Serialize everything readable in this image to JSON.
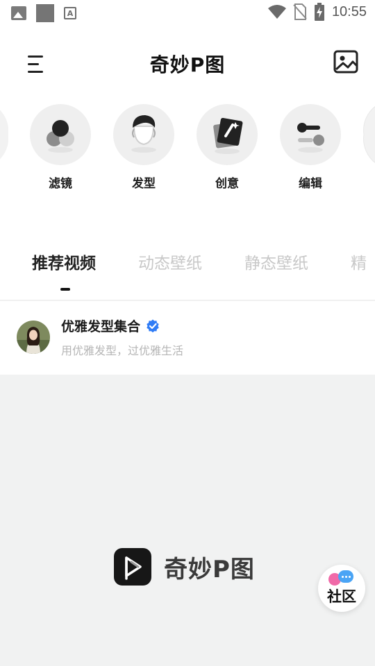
{
  "status_bar": {
    "time": "10:55"
  },
  "header": {
    "title": "奇妙P图"
  },
  "categories": [
    {
      "label": "滤镜",
      "icon": "filter-icon"
    },
    {
      "label": "发型",
      "icon": "hairstyle-icon"
    },
    {
      "label": "创意",
      "icon": "creative-icon"
    },
    {
      "label": "编辑",
      "icon": "edit-icon"
    }
  ],
  "tabs": [
    {
      "label": "推荐视频",
      "active": true
    },
    {
      "label": "动态壁纸",
      "active": false
    },
    {
      "label": "静态壁纸",
      "active": false
    },
    {
      "label": "精",
      "active": false
    }
  ],
  "post": {
    "title": "优雅发型集合",
    "subtitle": "用优雅发型，过优雅生活",
    "verified": true
  },
  "watermark": {
    "text": "奇妙P图"
  },
  "community_button": {
    "label": "社区"
  },
  "colors": {
    "verified_blue": "#2f7cf6",
    "community_pink": "#f06aa8",
    "community_blue": "#4aa4f5",
    "content_bg": "#f1f2f2"
  }
}
